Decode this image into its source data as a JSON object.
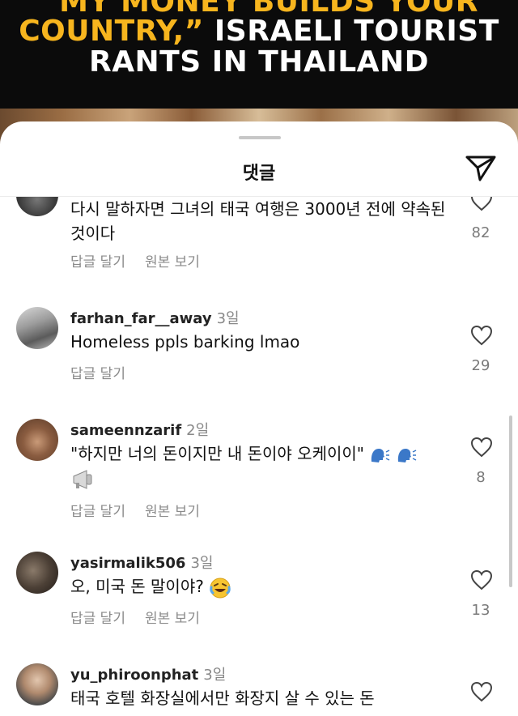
{
  "video": {
    "headline_line1": "“MY MONEY BUILDS YOUR",
    "headline_line2_yellow": "COUNTRY,”",
    "headline_line2_white": " ISRAELI TOURIST",
    "headline_line3": "RANTS IN THAILAND"
  },
  "sheet": {
    "title": "댓글",
    "send_icon": "paper-plane-icon"
  },
  "comments": [
    {
      "username": "",
      "time": "",
      "text": "다시 말하자면 그녀의 태국 여행은 3000년 전에 약속된 것이다",
      "reply": "답글 달기",
      "translation": "원본 보기",
      "likes": "82"
    },
    {
      "username": "farhan_far__away",
      "time": "3일",
      "text": "Homeless ppls barking lmao",
      "reply": "답글 달기",
      "translation": "",
      "likes": "29"
    },
    {
      "username": "sameennzarif",
      "time": "2일",
      "text": "\"하지만 너의 돈이지만 내 돈이야 오케이이\"",
      "reply": "답글 달기",
      "translation": "원본 보기",
      "likes": "8"
    },
    {
      "username": "yasirmalik506",
      "time": "3일",
      "text": "오, 미국 돈 말이야?",
      "reply": "답글 달기",
      "translation": "원본 보기",
      "likes": "13"
    },
    {
      "username": "yu_phiroonphat",
      "time": "3일",
      "text": "태국 호텔 화장실에서만 화장지 살 수 있는 돈",
      "reply": "",
      "translation": "",
      "likes": ""
    }
  ],
  "colors": {
    "headline_yellow": "#f7b51e",
    "sheet_bg": "#ffffff",
    "meta_gray": "#8a8a8a"
  }
}
